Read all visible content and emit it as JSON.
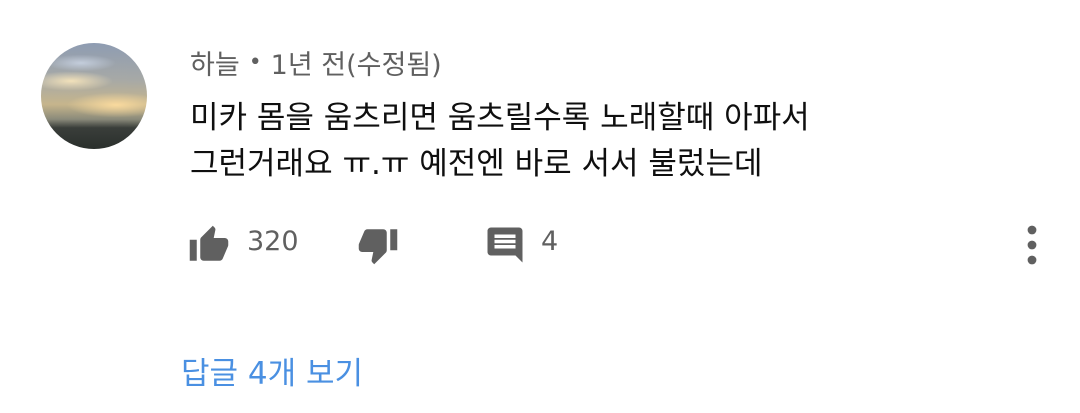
{
  "comment": {
    "author": "하늘",
    "separator": "•",
    "time": "1년 전(수정됨)",
    "text_lines": [
      "미카 몸을 움츠리면 움츠릴수록 노래할때 아파서",
      "그런거래요 ㅠ.ㅠ 예전엔 바로 서서 불렀는데"
    ],
    "likes": "320",
    "replies": "4",
    "view_replies_label": "답글 4개 보기"
  },
  "icons": {
    "avatar": "sunset-sky-avatar",
    "like": "thumbs-up-icon",
    "dislike": "thumbs-down-icon",
    "reply": "comment-icon",
    "more": "more-vert-icon"
  },
  "colors": {
    "text": "#0f0f0f",
    "meta": "#606060",
    "icon": "#606060",
    "link": "#4a90e2"
  }
}
